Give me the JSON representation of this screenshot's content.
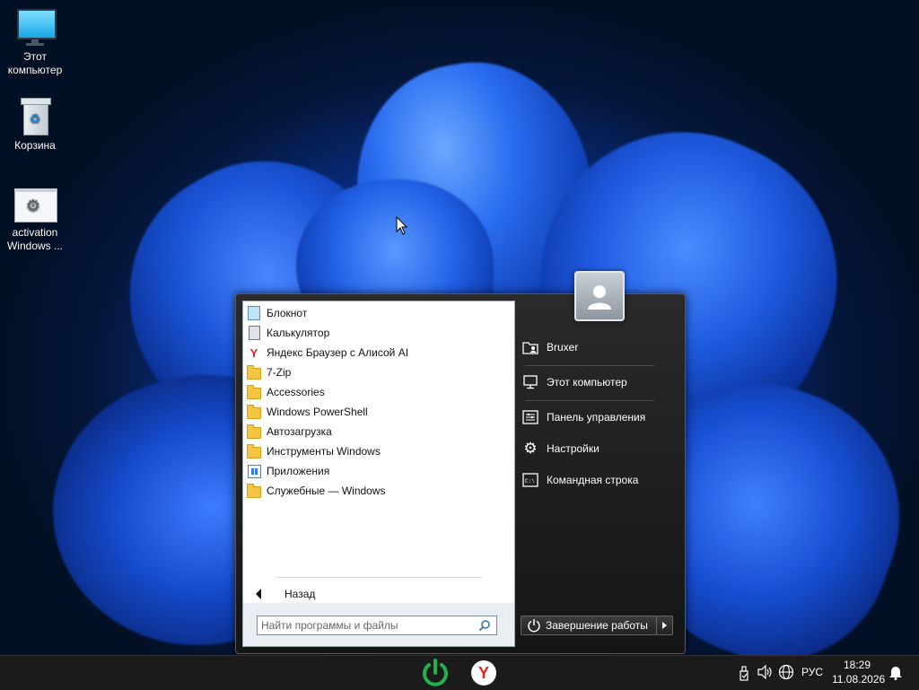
{
  "desktop": {
    "icons": [
      {
        "label": "Этот компьютер",
        "icon": "monitor-icon"
      },
      {
        "label": "Корзина",
        "icon": "recycle-bin-icon"
      },
      {
        "label": "activation Windows ...",
        "icon": "settings-file-icon"
      }
    ]
  },
  "start_menu": {
    "programs": [
      {
        "label": "Блокнот",
        "icon": "notepad-icon"
      },
      {
        "label": "Калькулятор",
        "icon": "calculator-icon"
      },
      {
        "label": "Яндекс Браузер с Алисой AI",
        "icon": "yandex-browser-icon"
      },
      {
        "label": "7-Zip",
        "icon": "folder-icon"
      },
      {
        "label": "Accessories",
        "icon": "folder-icon"
      },
      {
        "label": "Windows PowerShell",
        "icon": "folder-icon"
      },
      {
        "label": "Автозагрузка",
        "icon": "folder-icon"
      },
      {
        "label": "Инструменты Windows",
        "icon": "folder-icon"
      },
      {
        "label": "Приложения",
        "icon": "apps-folder-icon"
      },
      {
        "label": "Служебные — Windows",
        "icon": "folder-icon"
      }
    ],
    "back_label": "Назад",
    "search_placeholder": "Найти программы и файлы",
    "right_items": [
      {
        "label": "Bruxer",
        "icon": "user-folder-icon"
      },
      {
        "label": "Этот компьютер",
        "icon": "computer-icon"
      },
      {
        "label": "Панель управления",
        "icon": "control-panel-icon"
      },
      {
        "label": "Настройки",
        "icon": "gear-icon"
      },
      {
        "label": "Командная строка",
        "icon": "command-prompt-icon"
      }
    ],
    "shutdown_label": "Завершение работы"
  },
  "taskbar": {
    "language": "РУС",
    "time": "18:29",
    "date": "11.08.2026"
  },
  "colors": {
    "start_button": "#22b14c",
    "yandex_red": "#e8231f",
    "folder_yellow": "#f4c542"
  }
}
